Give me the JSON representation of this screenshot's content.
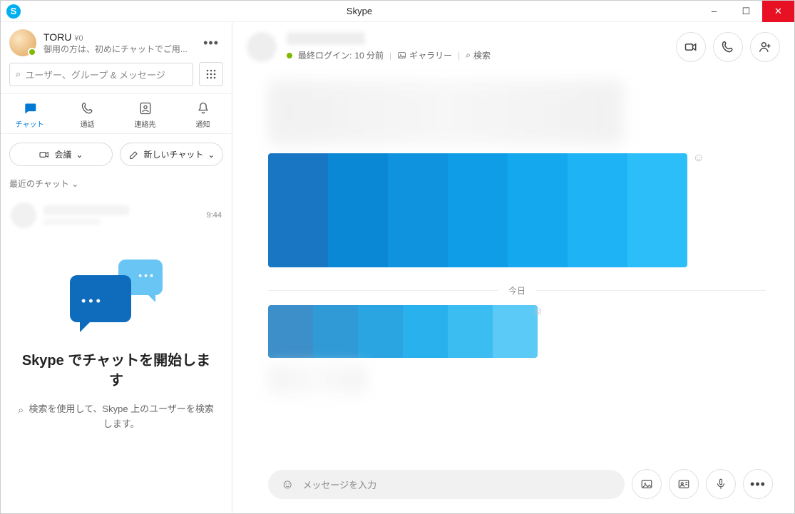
{
  "app_title": "Skype",
  "window_controls": {
    "min": "–",
    "max": "☐",
    "close": "✕"
  },
  "profile": {
    "name": "TORU",
    "credit": "¥0",
    "status_line": "御用の方は、初めにチャットでご用..."
  },
  "search": {
    "placeholder": "ユーザー、グループ & メッセージ"
  },
  "nav": {
    "chat": "チャット",
    "calls": "通話",
    "contacts": "連絡先",
    "notifications": "通知"
  },
  "actions": {
    "meeting": "会議",
    "new_chat": "新しいチャット"
  },
  "recent": {
    "header": "最近のチャット",
    "item_time": "9:44"
  },
  "empty": {
    "title": "Skype でチャットを開始します",
    "hint": "検索を使用して、Skype 上のユーザーを検索します。"
  },
  "conversation": {
    "last_login_label": "最終ログイン:",
    "last_login_value": "10 分前",
    "gallery": "ギャラリー",
    "search": "検索",
    "today": "今日"
  },
  "composer": {
    "placeholder": "メッセージを入力"
  },
  "icons": {
    "dots": "•••",
    "chevron": "⌄",
    "search": "⌕",
    "emoji": "☺"
  },
  "colors": {
    "accent": "#0078d4",
    "skype_blue": "#00aff0",
    "close_red": "#e81123",
    "presence_green": "#7fba00"
  }
}
